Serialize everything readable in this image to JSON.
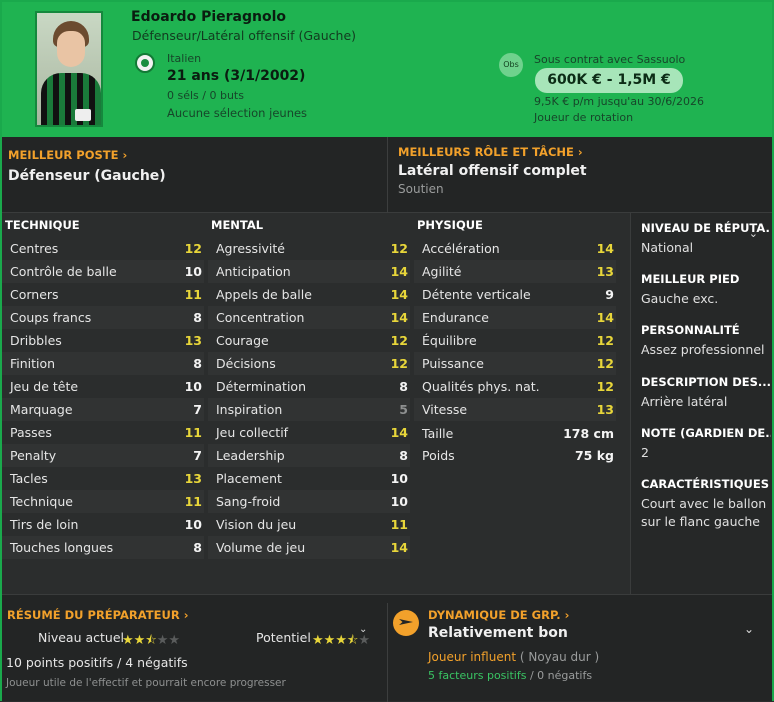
{
  "player": {
    "name": "Edoardo Pieragnolo",
    "role": "Défenseur/Latéral offensif (Gauche)",
    "nationality": "Italien",
    "age": "21 ans (3/1/2002)",
    "selections": "0 séls / 0 buts",
    "youth": "Aucune sélection jeunes",
    "obs_label": "Obs",
    "contract": "Sous contrat avec Sassuolo",
    "value": "600K € - 1,5M €",
    "wage": "9,5K € p/m jusqu'au 30/6/2026",
    "status": "Joueur de rotation"
  },
  "best": {
    "position_label": "MEILLEUR POSTE",
    "position": "Défenseur (Gauche)",
    "role_label": "MEILLEURS RÔLE ET TÂCHE",
    "role": "Latéral offensif complet",
    "duty": "Soutien"
  },
  "attributes": {
    "technical": {
      "title": "TECHNIQUE",
      "rows": [
        {
          "label": "Centres",
          "value": "12",
          "tone": "yellow"
        },
        {
          "label": "Contrôle de balle",
          "value": "10",
          "tone": "white"
        },
        {
          "label": "Corners",
          "value": "11",
          "tone": "yellow"
        },
        {
          "label": "Coups francs",
          "value": "8",
          "tone": "white"
        },
        {
          "label": "Dribbles",
          "value": "13",
          "tone": "yellow"
        },
        {
          "label": "Finition",
          "value": "8",
          "tone": "white"
        },
        {
          "label": "Jeu de tête",
          "value": "10",
          "tone": "white"
        },
        {
          "label": "Marquage",
          "value": "7",
          "tone": "white"
        },
        {
          "label": "Passes",
          "value": "11",
          "tone": "yellow"
        },
        {
          "label": "Penalty",
          "value": "7",
          "tone": "white"
        },
        {
          "label": "Tacles",
          "value": "13",
          "tone": "yellow"
        },
        {
          "label": "Technique",
          "value": "11",
          "tone": "yellow"
        },
        {
          "label": "Tirs de loin",
          "value": "10",
          "tone": "white"
        },
        {
          "label": "Touches longues",
          "value": "8",
          "tone": "white"
        }
      ]
    },
    "mental": {
      "title": "MENTAL",
      "rows": [
        {
          "label": "Agressivité",
          "value": "12",
          "tone": "yellow"
        },
        {
          "label": "Anticipation",
          "value": "14",
          "tone": "yellow"
        },
        {
          "label": "Appels de balle",
          "value": "14",
          "tone": "yellow"
        },
        {
          "label": "Concentration",
          "value": "14",
          "tone": "yellow"
        },
        {
          "label": "Courage",
          "value": "12",
          "tone": "yellow"
        },
        {
          "label": "Décisions",
          "value": "12",
          "tone": "yellow"
        },
        {
          "label": "Détermination",
          "value": "8",
          "tone": "white"
        },
        {
          "label": "Inspiration",
          "value": "5",
          "tone": "gray"
        },
        {
          "label": "Jeu collectif",
          "value": "14",
          "tone": "yellow"
        },
        {
          "label": "Leadership",
          "value": "8",
          "tone": "white"
        },
        {
          "label": "Placement",
          "value": "10",
          "tone": "white"
        },
        {
          "label": "Sang-froid",
          "value": "10",
          "tone": "white"
        },
        {
          "label": "Vision du jeu",
          "value": "11",
          "tone": "yellow"
        },
        {
          "label": "Volume de jeu",
          "value": "14",
          "tone": "yellow"
        }
      ]
    },
    "physical": {
      "title": "PHYSIQUE",
      "rows": [
        {
          "label": "Accélération",
          "value": "14",
          "tone": "yellow"
        },
        {
          "label": "Agilité",
          "value": "13",
          "tone": "yellow"
        },
        {
          "label": "Détente verticale",
          "value": "9",
          "tone": "white"
        },
        {
          "label": "Endurance",
          "value": "14",
          "tone": "yellow"
        },
        {
          "label": "Équilibre",
          "value": "12",
          "tone": "yellow"
        },
        {
          "label": "Puissance",
          "value": "12",
          "tone": "yellow"
        },
        {
          "label": "Qualités phys. nat.",
          "value": "12",
          "tone": "yellow"
        },
        {
          "label": "Vitesse",
          "value": "13",
          "tone": "yellow"
        }
      ],
      "extra": [
        {
          "label": "Taille",
          "value": "178 cm"
        },
        {
          "label": "Poids",
          "value": "75 kg"
        }
      ]
    }
  },
  "side": [
    {
      "title": "NIVEAU DE RÉPUTA...",
      "value": "National"
    },
    {
      "title": "MEILLEUR PIED",
      "value": "Gauche exc."
    },
    {
      "title": "PERSONNALITÉ",
      "value": "Assez professionnel"
    },
    {
      "title": "DESCRIPTION DES...",
      "value": "Arrière latéral"
    },
    {
      "title": "NOTE (GARDIEN DE...",
      "value": "2"
    },
    {
      "title": "CARACTÉRISTIQUES J",
      "value": "Court avec le ballon sur le flanc gauche"
    }
  ],
  "coach": {
    "title": "RÉSUMÉ DU PRÉPARATEUR",
    "current_label": "Niveau actuel",
    "current_stars": 2.5,
    "potential_label": "Potentiel",
    "potential_stars": 3.5,
    "points": "10 points positifs / 4 négatifs",
    "note": "Joueur utile de l'effectif et pourrait encore progresser"
  },
  "dynamics": {
    "title": "DYNAMIQUE DE GRP.",
    "value": "Relativement bon",
    "role": "Joueur influent",
    "group": "( Noyau dur )",
    "positives": "5 facteurs positifs",
    "negatives": "0 négatifs"
  },
  "colors": {
    "accent": "#1fb351",
    "highlight": "#e8d63a",
    "link": "#f2a12b"
  }
}
